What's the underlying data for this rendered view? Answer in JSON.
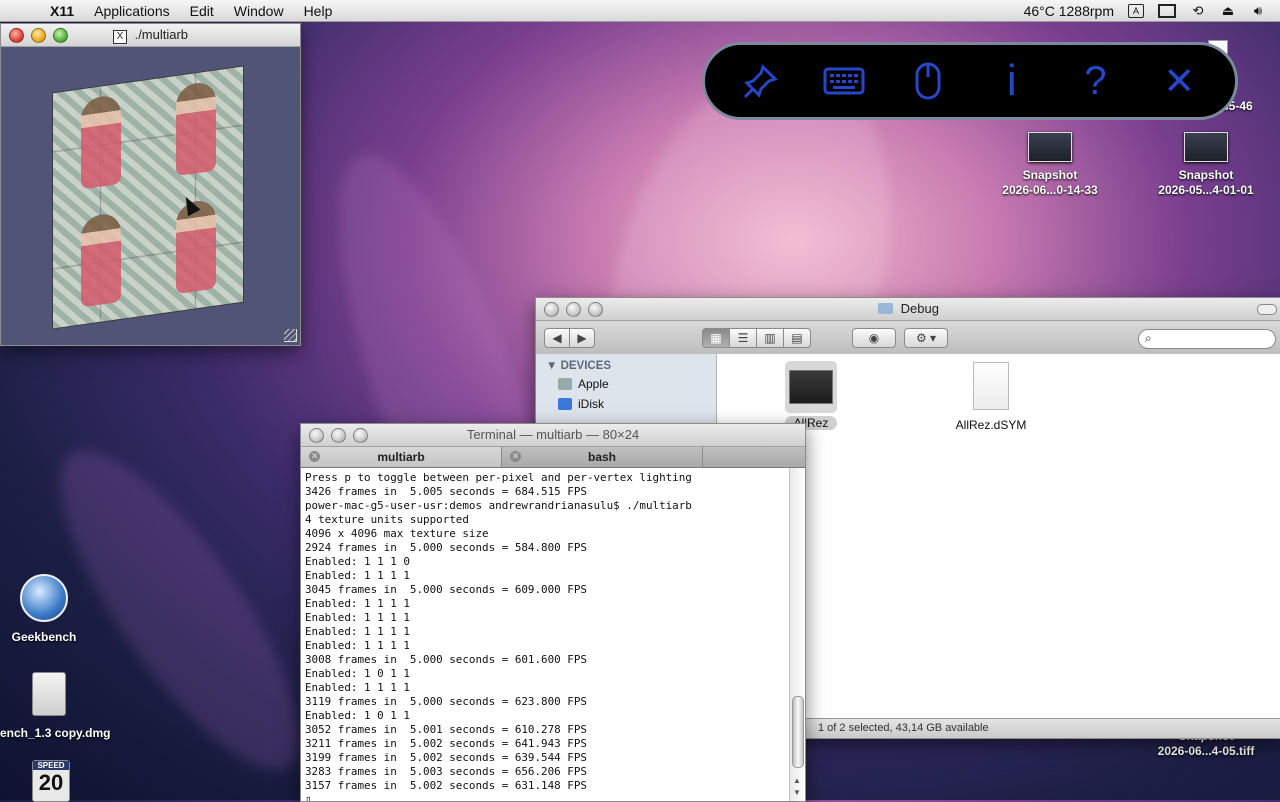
{
  "menubar": {
    "apple_symbol": "",
    "items": [
      "X11",
      "Applications",
      "Edit",
      "Window",
      "Help"
    ],
    "status_text": "46°C 1288rpm"
  },
  "x11_window": {
    "title": "./multiarb"
  },
  "hud": {
    "buttons": [
      "pin-icon",
      "keyboard-icon",
      "mouse-icon",
      "info-icon",
      "help-icon",
      "close-icon"
    ],
    "info_glyph": "i",
    "help_glyph": "?",
    "close_glyph": "✕",
    "accent": "#2647c8"
  },
  "desktop": {
    "partial_label_top": "35-46",
    "snapshots": [
      {
        "line1": "Snapshot",
        "line2": "2026-06...0-14-33"
      },
      {
        "line1": "Snapshot",
        "line2": "2026-05...4-01-01"
      }
    ],
    "snapshot_bottom": {
      "line1": "Snapshot",
      "line2": "2026-06...4-05.tiff"
    },
    "geekbench_label": "Geekbench",
    "dmg_label": "ench_1.3 copy.dmg",
    "speed_badge": {
      "top": "SPEED",
      "number": "20"
    }
  },
  "finder": {
    "title": "Debug",
    "sidebar_header": "DEVICES",
    "sidebar_items": [
      "Apple",
      "iDisk"
    ],
    "files": [
      {
        "name": "AllRez",
        "selected": true
      },
      {
        "name": "AllRez.dSYM",
        "selected": false
      }
    ],
    "status": "1 of 2 selected, 43,14 GB available"
  },
  "terminal": {
    "title": "Terminal — multiarb — 80×24",
    "tabs": [
      {
        "label": "multiarb",
        "active": true
      },
      {
        "label": "bash",
        "active": false
      }
    ],
    "lines": [
      "Press p to toggle between per-pixel and per-vertex lighting",
      "3426 frames in  5.005 seconds = 684.515 FPS",
      "power-mac-g5-user-usr:demos andrewrandrianasulu$ ./multiarb",
      "4 texture units supported",
      "4096 x 4096 max texture size",
      "2924 frames in  5.000 seconds = 584.800 FPS",
      "Enabled: 1 1 1 0",
      "Enabled: 1 1 1 1",
      "3045 frames in  5.000 seconds = 609.000 FPS",
      "Enabled: 1 1 1 1",
      "Enabled: 1 1 1 1",
      "Enabled: 1 1 1 1",
      "Enabled: 1 1 1 1",
      "3008 frames in  5.000 seconds = 601.600 FPS",
      "Enabled: 1 0 1 1",
      "Enabled: 1 1 1 1",
      "3119 frames in  5.000 seconds = 623.800 FPS",
      "Enabled: 1 0 1 1",
      "3052 frames in  5.001 seconds = 610.278 FPS",
      "3211 frames in  5.002 seconds = 641.943 FPS",
      "3199 frames in  5.002 seconds = 639.544 FPS",
      "3283 frames in  5.003 seconds = 656.206 FPS",
      "3157 frames in  5.002 seconds = 631.148 FPS",
      "▯"
    ]
  }
}
